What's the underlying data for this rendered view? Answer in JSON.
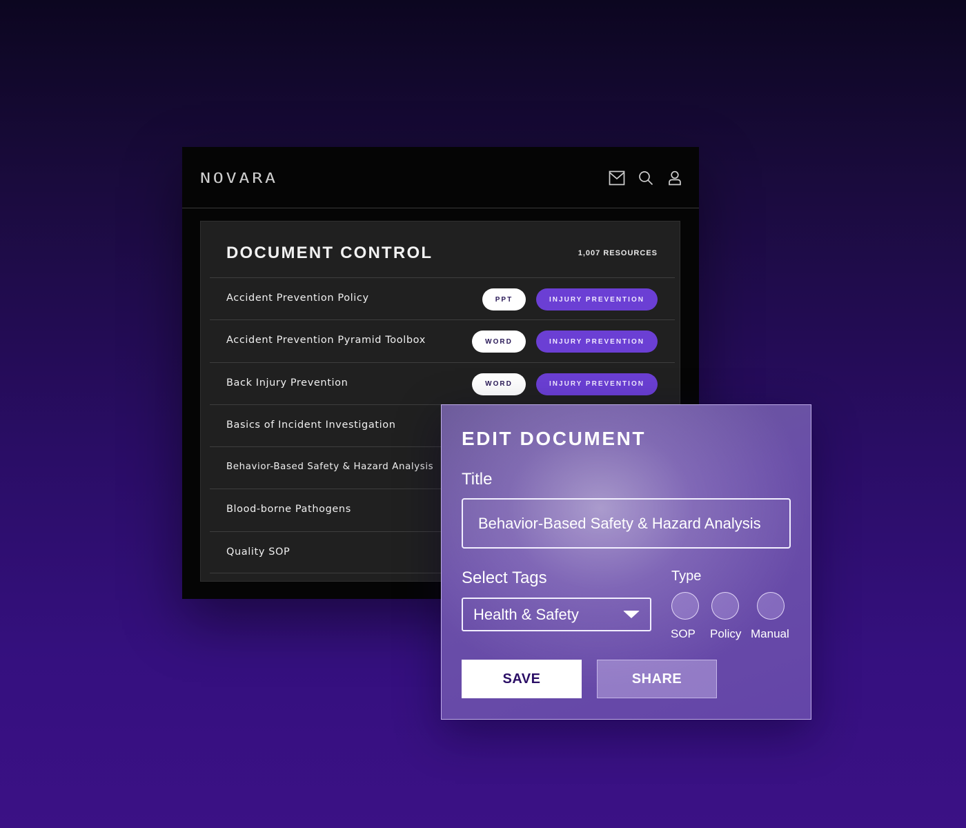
{
  "app": {
    "logo": "NOVARA",
    "header_icons": [
      "mail-icon",
      "search-icon",
      "user-icon"
    ]
  },
  "document_control": {
    "title": "DOCUMENT CONTROL",
    "resource_count": "1,007 RESOURCES",
    "documents": [
      {
        "name": "Accident Prevention Policy",
        "type": "PPT",
        "tag": "INJURY PREVENTION"
      },
      {
        "name": "Accident Prevention Pyramid Toolbox",
        "type": "WORD",
        "tag": "INJURY PREVENTION"
      },
      {
        "name": "Back Injury Prevention",
        "type": "WORD",
        "tag": "INJURY PREVENTION"
      },
      {
        "name": "Basics of Incident Investigation"
      },
      {
        "name": "Behavior-Based Safety & Hazard Analysis"
      },
      {
        "name": "Blood-borne Pathogens"
      },
      {
        "name": "Quality SOP"
      }
    ]
  },
  "edit_document": {
    "heading": "EDIT DOCUMENT",
    "title_label": "Title",
    "title_value": "Behavior-Based Safety & Hazard Analysis",
    "tags_label": "Select Tags",
    "tags_selected": "Health & Safety",
    "type_label": "Type",
    "type_options": [
      "SOP",
      "Policy",
      "Manual"
    ],
    "save_label": "SAVE",
    "share_label": "SHARE"
  },
  "colors": {
    "tag_chip": "#6b3fd4",
    "type_chip": "#ffffff",
    "save_button_text": "#2b0f66"
  }
}
